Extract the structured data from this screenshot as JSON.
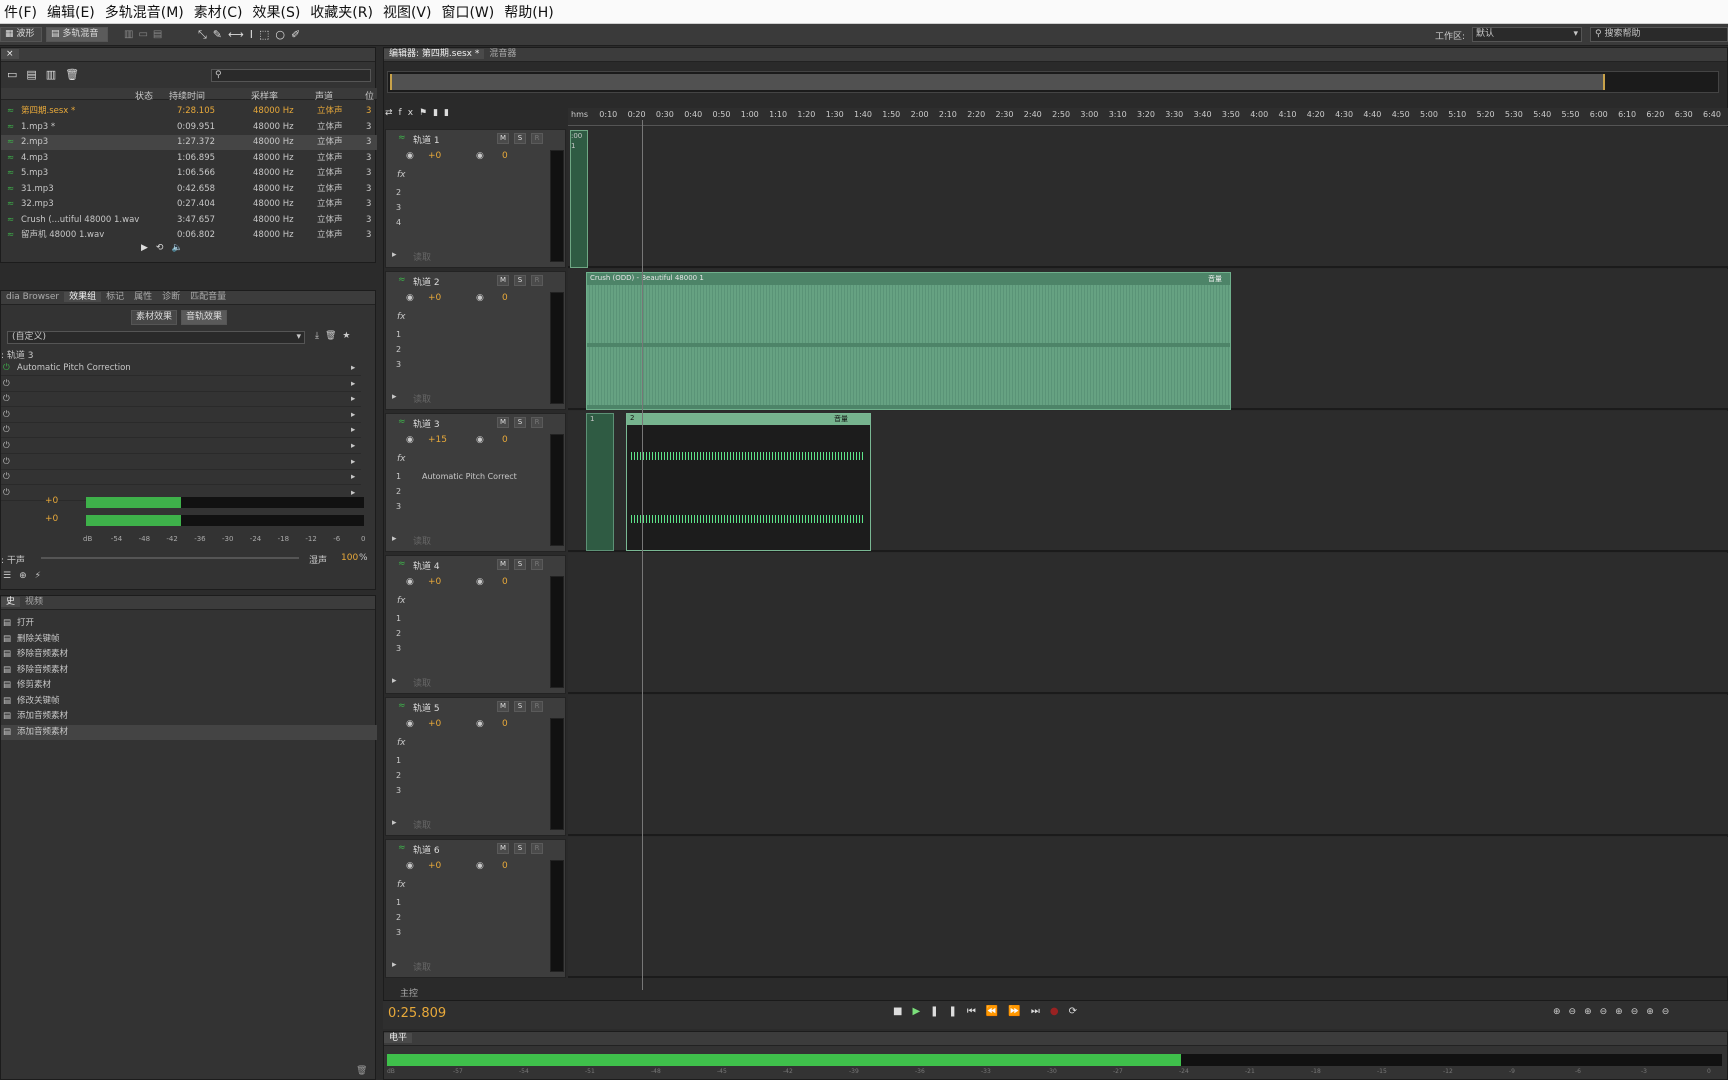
{
  "menu": [
    "件(F)",
    "编辑(E)",
    "多轨混音(M)",
    "素材(C)",
    "效果(S)",
    "收藏夹(R)",
    "视图(V)",
    "窗口(W)",
    "帮助(H)"
  ],
  "toolbar": {
    "waveform": "波形",
    "multitrack": "多轨混音",
    "workspace_label": "工作区:",
    "workspace_value": "默认",
    "search_placeholder": "搜索帮助"
  },
  "files": {
    "headers": [
      "状态",
      "持续时间",
      "采样率",
      "声道",
      "位"
    ],
    "rows": [
      {
        "name": "第四期.sesx *",
        "duration": "7:28.105",
        "rate": "48000 Hz",
        "channels": "立体声",
        "bits": "3"
      },
      {
        "name": "1.mp3 *",
        "duration": "0:09.951",
        "rate": "48000 Hz",
        "channels": "立体声",
        "bits": "3"
      },
      {
        "name": "2.mp3",
        "duration": "1:27.372",
        "rate": "48000 Hz",
        "channels": "立体声",
        "bits": "3"
      },
      {
        "name": "4.mp3",
        "duration": "1:06.895",
        "rate": "48000 Hz",
        "channels": "立体声",
        "bits": "3"
      },
      {
        "name": "5.mp3",
        "duration": "1:06.566",
        "rate": "48000 Hz",
        "channels": "立体声",
        "bits": "3"
      },
      {
        "name": "31.mp3",
        "duration": "0:42.658",
        "rate": "48000 Hz",
        "channels": "立体声",
        "bits": "3"
      },
      {
        "name": "32.mp3",
        "duration": "0:27.404",
        "rate": "48000 Hz",
        "channels": "立体声",
        "bits": "3"
      },
      {
        "name": "Crush (...utiful 48000 1.wav",
        "duration": "3:47.657",
        "rate": "48000 Hz",
        "channels": "立体声",
        "bits": "3"
      },
      {
        "name": "留声机 48000 1.wav",
        "duration": "0:06.802",
        "rate": "48000 Hz",
        "channels": "立体声",
        "bits": "3"
      }
    ]
  },
  "effects": {
    "tabs": [
      "dia Browser",
      "效果组",
      "标记",
      "属性",
      "诊断",
      "匹配音量"
    ],
    "subtabs": [
      "素材效果",
      "音轨效果"
    ],
    "preset": "(自定义)",
    "track_label": ": 轨道 3",
    "slots": [
      "Automatic Pitch Correction",
      "",
      "",
      "",
      "",
      "",
      "",
      "",
      ""
    ],
    "in_label": ":",
    "in_val": "+0",
    "out_val": "+0",
    "scale": [
      "dB",
      "-54",
      "-48",
      "-42",
      "-36",
      "-30",
      "-24",
      "-18",
      "-12",
      "-6",
      "0"
    ],
    "dry_label": ": 干声",
    "wet_label": "湿声",
    "wet_val": "100",
    "wet_unit": "%"
  },
  "history": {
    "tabs": [
      "史",
      "视频"
    ],
    "items": [
      "打开",
      "删除关键帧",
      "移除音频素材",
      "移除音频素材",
      "修剪素材",
      "修改关键帧",
      "添加音频素材",
      "添加音频素材"
    ]
  },
  "editor": {
    "tabs": [
      "编辑器: 第四期.sesx *",
      "混音器"
    ],
    "ruler": [
      "hms",
      "0:10",
      "0:20",
      "0:30",
      "0:40",
      "0:50",
      "1:00",
      "1:10",
      "1:20",
      "1:30",
      "1:40",
      "1:50",
      "2:00",
      "2:10",
      "2:20",
      "2:30",
      "2:40",
      "2:50",
      "3:00",
      "3:10",
      "3:20",
      "3:30",
      "3:40",
      "3:50",
      "4:00",
      "4:10",
      "4:20",
      "4:30",
      "4:40",
      "4:50",
      "5:00",
      "5:10",
      "5:20",
      "5:30",
      "5:40",
      "5:50",
      "6:00",
      "6:10",
      "6:20",
      "6:30",
      "6:40"
    ],
    "tracks": [
      {
        "name": "轨道 1",
        "vol": "+0",
        "pan": "0",
        "sends": [
          "2",
          "3",
          "4"
        ],
        "fx": "",
        "read": "读取"
      },
      {
        "name": "轨道 2",
        "vol": "+0",
        "pan": "0",
        "sends": [
          "1",
          "2",
          "3"
        ],
        "fx": "",
        "read": "读取"
      },
      {
        "name": "轨道 3",
        "vol": "+15",
        "pan": "0",
        "sends": [
          "1",
          "2",
          "3"
        ],
        "fx": "Automatic Pitch Correct",
        "read": "读取"
      },
      {
        "name": "轨道 4",
        "vol": "+0",
        "pan": "0",
        "sends": [
          "1",
          "2",
          "3"
        ],
        "fx": "",
        "read": "读取"
      },
      {
        "name": "轨道 5",
        "vol": "+0",
        "pan": "0",
        "sends": [
          "1",
          "2",
          "3"
        ],
        "fx": "",
        "read": "读取"
      },
      {
        "name": "轨道 6",
        "vol": "+0",
        "pan": "0",
        "sends": [
          "1",
          "2",
          "3"
        ],
        "fx": "",
        "read": "读取"
      }
    ],
    "master": "主控",
    "clips": {
      "clip1": ":00 1",
      "clip2": "Crush (ODD) - Beautiful 48000 1",
      "clip2_tag": "音量",
      "clip3a": "1",
      "clip3b": "2",
      "clip3_tag": "音量"
    },
    "time": "0:25.809"
  },
  "levels": {
    "label": "电平",
    "scale": [
      "dB",
      "-57",
      "-54",
      "-51",
      "-48",
      "-45",
      "-42",
      "-39",
      "-36",
      "-33",
      "-30",
      "-27",
      "-24",
      "-21",
      "-18",
      "-15",
      "-12",
      "-9",
      "-6",
      "-3",
      "0"
    ]
  }
}
